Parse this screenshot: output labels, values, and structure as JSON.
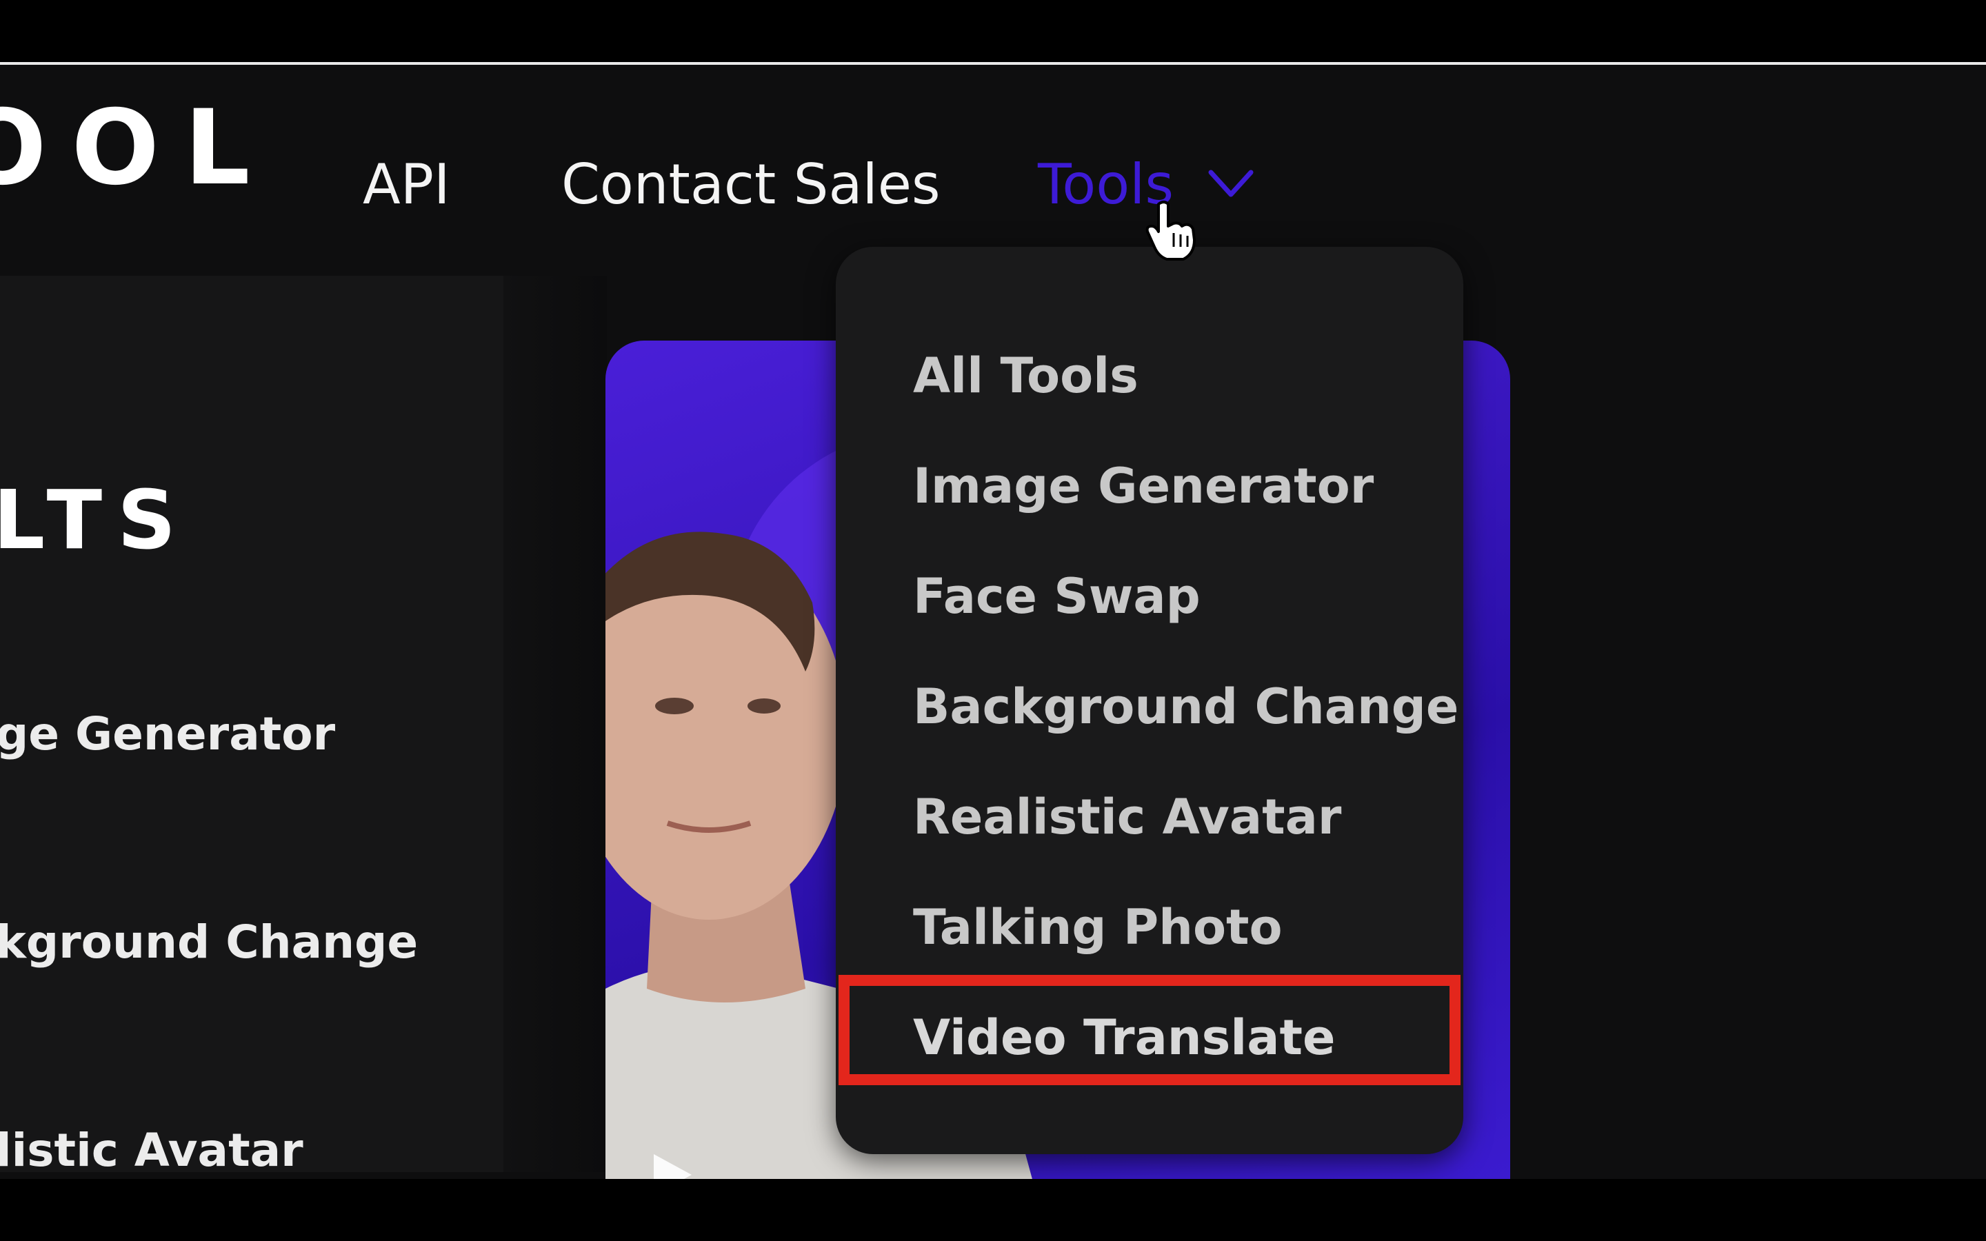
{
  "header": {
    "logo_text": "OOL",
    "nav": {
      "api": "API",
      "contact_sales": "Contact Sales",
      "tools": "Tools"
    }
  },
  "left_panel": {
    "title": "LTS",
    "items": [
      "ge Generator",
      "kground Change",
      "listic Avatar"
    ]
  },
  "dropdown": {
    "items": [
      "All Tools",
      "Image Generator",
      "Face Swap",
      "Background Change",
      "Realistic Avatar",
      "Talking Photo",
      "Video Translate"
    ],
    "highlighted_index": 6
  },
  "colors": {
    "tools_active": "#3d1bd6",
    "highlight_border": "#e3261c",
    "hero_bg": "#3b1bcf"
  }
}
